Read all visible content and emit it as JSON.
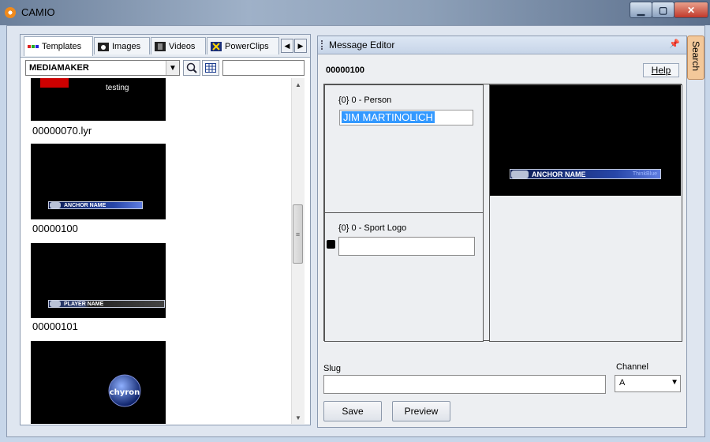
{
  "window": {
    "title": "CAMIO"
  },
  "tabs": [
    {
      "label": "Templates",
      "icon": "templates-icon"
    },
    {
      "label": "Images",
      "icon": "camera-icon"
    },
    {
      "label": "Videos",
      "icon": "film-icon"
    },
    {
      "label": "PowerClips",
      "icon": "powerclips-icon"
    }
  ],
  "toolbar": {
    "server": "MEDIAMAKER",
    "search_value": ""
  },
  "templates": [
    {
      "caption": "00000070.lyr",
      "thumb_text": "testing"
    },
    {
      "caption": "00000100",
      "thumb_text": "ANCHOR NAME",
      "thumb_brand": "ThinkBlue"
    },
    {
      "caption": "00000101",
      "thumb_text": "PLAYER NAME"
    },
    {
      "caption": "",
      "thumb_logo": "chyron"
    }
  ],
  "editor": {
    "title": "Message Editor",
    "message_id": "00000100",
    "help_label": "Help",
    "fields": [
      {
        "label": "{0} 0 - Person",
        "value": "JIM MARTINOLICH"
      },
      {
        "label": "{0} 0 - Sport Logo",
        "value": ""
      }
    ],
    "preview": {
      "name_text": "ANCHOR NAME",
      "brand": "ThinkBlue"
    },
    "slug_label": "Slug",
    "slug_value": "",
    "channel_label": "Channel",
    "channel_value": "A",
    "save_label": "Save",
    "preview_label": "Preview"
  },
  "side_tab": {
    "label": "Search"
  },
  "colors": {
    "selection": "#3399ff",
    "accent_tab": "#f3c89a"
  }
}
